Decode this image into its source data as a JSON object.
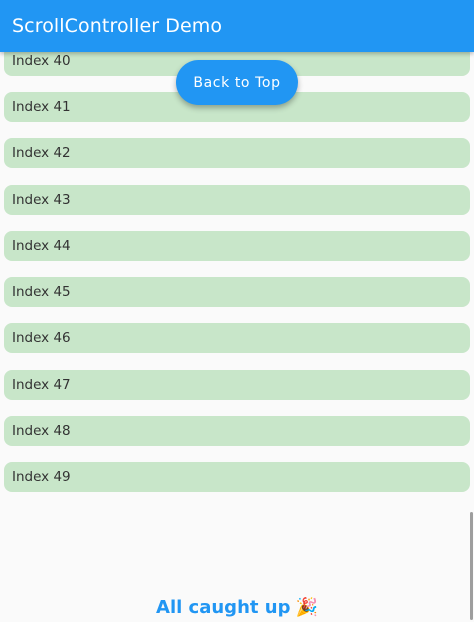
{
  "app_bar": {
    "title": "ScrollController Demo"
  },
  "fab": {
    "label": "Back to Top"
  },
  "list": {
    "items": [
      {
        "label": "Index 40"
      },
      {
        "label": "Index 41"
      },
      {
        "label": "Index 42"
      },
      {
        "label": "Index 43"
      },
      {
        "label": "Index 44"
      },
      {
        "label": "Index 45"
      },
      {
        "label": "Index 46"
      },
      {
        "label": "Index 47"
      },
      {
        "label": "Index 48"
      },
      {
        "label": "Index 49"
      }
    ]
  },
  "footer": {
    "text": "All caught up",
    "emoji": "🎉"
  },
  "colors": {
    "primary": "#2196f3",
    "item_background": "#c8e6c9",
    "background": "#fafafa"
  }
}
